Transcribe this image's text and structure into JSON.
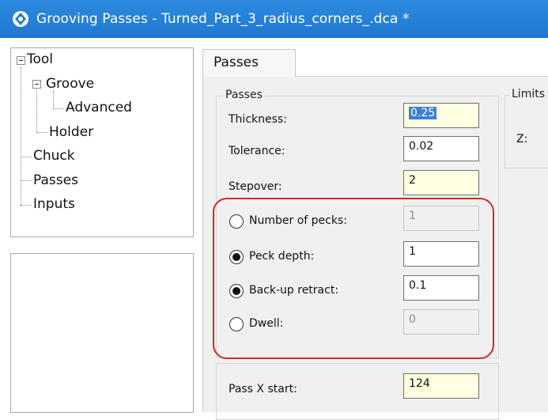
{
  "window": {
    "title": "Grooving Passes - Turned_Part_3_radius_corners_.dca *"
  },
  "tree": {
    "items": [
      {
        "label": "Tool"
      },
      {
        "label": "Groove"
      },
      {
        "label": "Advanced"
      },
      {
        "label": "Holder"
      },
      {
        "label": "Chuck"
      },
      {
        "label": "Passes"
      },
      {
        "label": "Inputs"
      }
    ]
  },
  "tabs": [
    {
      "label": "Passes"
    }
  ],
  "passes_group": {
    "title": "Passes",
    "thickness": {
      "label": "Thickness:",
      "value": "0.25"
    },
    "tolerance": {
      "label": "Tolerance:",
      "value": "0.02"
    },
    "stepover": {
      "label": "Stepover:",
      "value": "2"
    },
    "number_of_pecks": {
      "label": "Number of pecks:",
      "value": "1",
      "selected": false
    },
    "peck_depth": {
      "label": "Peck depth:",
      "value": "1",
      "selected": true
    },
    "backup_retract": {
      "label": "Back-up retract:",
      "value": "0.1",
      "selected": true
    },
    "dwell": {
      "label": "Dwell:",
      "value": "0",
      "selected": false
    }
  },
  "limits_group": {
    "title": "Limits",
    "z_label": "Z:"
  },
  "pass_x_start": {
    "label": "Pass X start:",
    "value": "124"
  },
  "colors": {
    "titlebar": "#1f78d2",
    "highlight": "#d12b2b",
    "input_yellow": "#ffffe1",
    "selection": "#3d7fd6"
  }
}
